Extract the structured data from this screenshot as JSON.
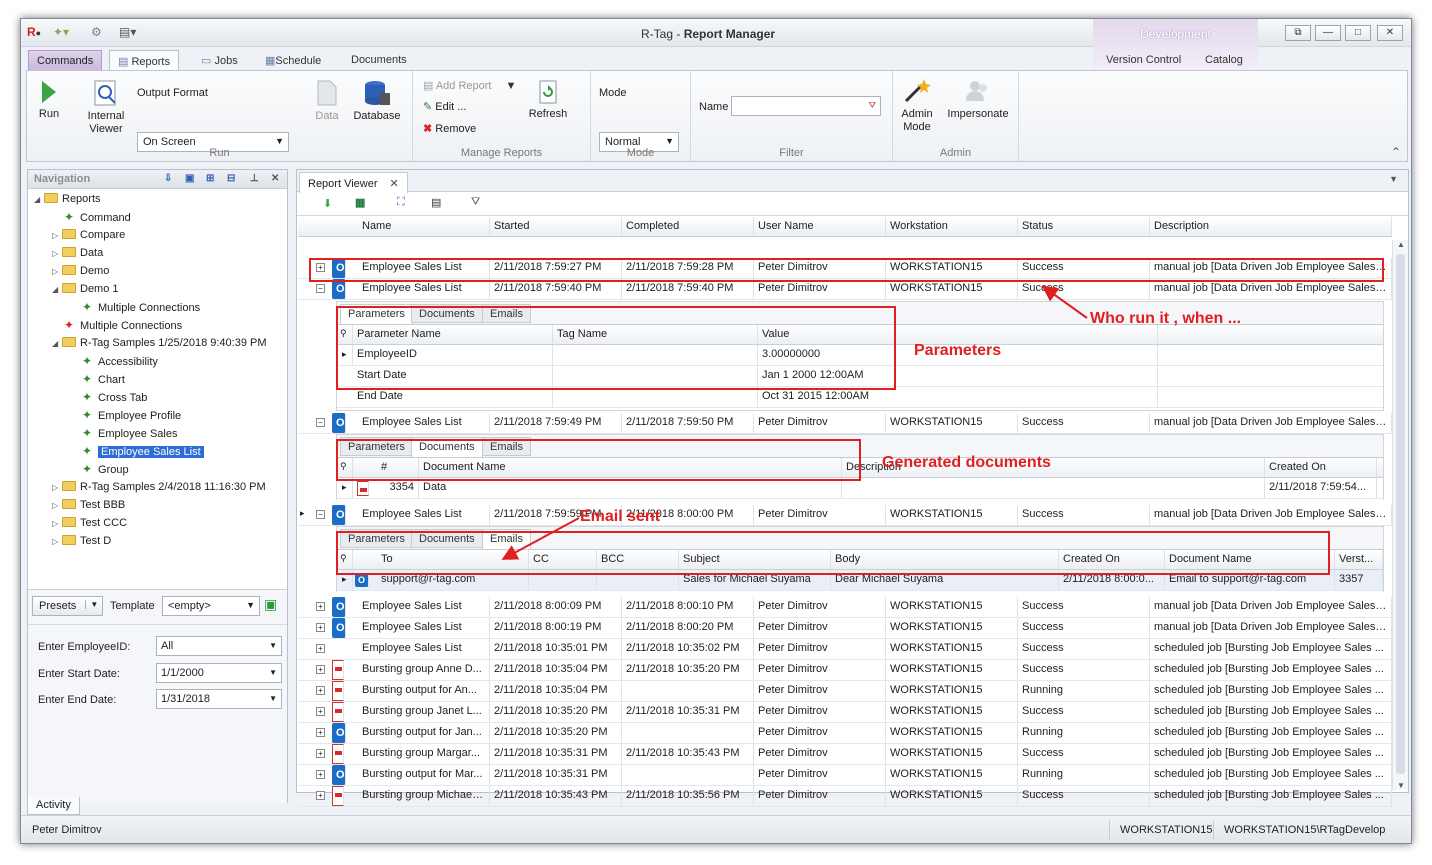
{
  "window": {
    "title_prefix": "R-Tag - ",
    "title_main": "Report Manager",
    "context_tab": "Development",
    "controls": [
      "⧉",
      "—",
      "□",
      "✕"
    ]
  },
  "ribbon_tabs": {
    "commands": "Commands",
    "reports": "Reports",
    "jobs": "Jobs",
    "schedule": "Schedule",
    "documents": "Documents",
    "version_control": "Version Control",
    "catalog": "Catalog"
  },
  "ribbon": {
    "run": "Run",
    "internal_viewer_1": "Internal",
    "internal_viewer_2": "Viewer",
    "output_format_label": "Output Format",
    "output_format_value": "On Screen",
    "data": "Data",
    "database": "Database",
    "group_run": "Run",
    "add_report": "Add Report",
    "edit": "Edit ...",
    "remove": "Remove",
    "refresh": "Refresh",
    "group_manage": "Manage Reports",
    "mode_label": "Mode",
    "mode_value": "Normal",
    "group_mode": "Mode",
    "name_label": "Name",
    "name_value": "",
    "group_filter": "Filter",
    "admin_mode_1": "Admin",
    "admin_mode_2": "Mode",
    "impersonate": "Impersonate",
    "group_admin": "Admin"
  },
  "navigation": {
    "title": "Navigation",
    "tree": [
      {
        "label": "Reports",
        "type": "folder",
        "exp": "◢",
        "indent": 0
      },
      {
        "label": "Command",
        "type": "report",
        "exp": "",
        "indent": 1
      },
      {
        "label": "Compare",
        "type": "folder",
        "exp": "▷",
        "indent": 1
      },
      {
        "label": "Data",
        "type": "folder",
        "exp": "▷",
        "indent": 1
      },
      {
        "label": "Demo",
        "type": "folder",
        "exp": "▷",
        "indent": 1
      },
      {
        "label": "Demo 1",
        "type": "folder",
        "exp": "◢",
        "indent": 1
      },
      {
        "label": "Multiple  Connections",
        "type": "report",
        "exp": "",
        "indent": 2
      },
      {
        "label": "Multiple  Connections",
        "type": "report",
        "exp": "",
        "indent": 1
      },
      {
        "label": "R-Tag Samples 1/25/2018 9:40:39 PM",
        "type": "folder",
        "exp": "◢",
        "indent": 1
      },
      {
        "label": "Accessibility",
        "type": "report",
        "exp": "",
        "indent": 2
      },
      {
        "label": "Chart",
        "type": "report",
        "exp": "",
        "indent": 2
      },
      {
        "label": "Cross Tab",
        "type": "report",
        "exp": "",
        "indent": 2
      },
      {
        "label": "Employee  Profile",
        "type": "report",
        "exp": "",
        "indent": 2
      },
      {
        "label": "Employee  Sales",
        "type": "report",
        "exp": "",
        "indent": 2
      },
      {
        "label": "Employee Sales List",
        "type": "report",
        "exp": "",
        "indent": 2,
        "selected": true
      },
      {
        "label": "Group",
        "type": "report",
        "exp": "",
        "indent": 2
      },
      {
        "label": "R-Tag Samples 2/4/2018 11:16:30 PM",
        "type": "folder",
        "exp": "▷",
        "indent": 1
      },
      {
        "label": "Test BBB",
        "type": "folder",
        "exp": "▷",
        "indent": 1
      },
      {
        "label": "Test CCC",
        "type": "folder",
        "exp": "▷",
        "indent": 1
      },
      {
        "label": "Test D",
        "type": "folder",
        "exp": "▷",
        "indent": 1
      }
    ],
    "presets": "Presets",
    "template_label": "Template",
    "template_value": "<empty>",
    "params": [
      {
        "label": "Enter EmployeeID:",
        "value": "All"
      },
      {
        "label": "Enter Start Date:",
        "value": "1/1/2000"
      },
      {
        "label": "Enter End Date:",
        "value": "1/31/2018"
      }
    ],
    "activity": "Activity"
  },
  "viewer": {
    "tab": "Report Viewer",
    "columns": [
      "Name",
      "Started",
      "Completed",
      "User Name",
      "Workstation",
      "Status",
      "Description"
    ],
    "rows": [
      {
        "icon": "ol",
        "exp": "+",
        "name": "Employee Sales List",
        "started": "2/11/2018 7:59:27 PM",
        "completed": "2/11/2018 7:59:28 PM",
        "user": "Peter Dimitrov",
        "ws": "WORKSTATION15",
        "status": "Success",
        "desc": "manual job [Data Driven Job Employee Sales ..."
      },
      {
        "icon": "ol",
        "exp": "−",
        "name": "Employee Sales List",
        "started": "2/11/2018 7:59:40 PM",
        "completed": "2/11/2018 7:59:40 PM",
        "user": "Peter Dimitrov",
        "ws": "WORKSTATION15",
        "status": "Success",
        "desc": "manual job [Data Driven Job Employee Sales ..."
      },
      {
        "icon": "ol",
        "exp": "−",
        "name": "Employee Sales List",
        "started": "2/11/2018 7:59:49 PM",
        "completed": "2/11/2018 7:59:50 PM",
        "user": "Peter Dimitrov",
        "ws": "WORKSTATION15",
        "status": "Success",
        "desc": "manual job [Data Driven Job Employee Sales ..."
      },
      {
        "icon": "ol",
        "exp": "−",
        "name": "Employee Sales List",
        "started": "2/11/2018 7:59:59 PM",
        "completed": "2/11/2018 8:00:00 PM",
        "user": "Peter Dimitrov",
        "ws": "WORKSTATION15",
        "status": "Success",
        "desc": "manual job [Data Driven Job Employee Sales ..."
      },
      {
        "icon": "ol",
        "exp": "+",
        "name": "Employee Sales List",
        "started": "2/11/2018 8:00:09 PM",
        "completed": "2/11/2018 8:00:10 PM",
        "user": "Peter Dimitrov",
        "ws": "WORKSTATION15",
        "status": "Success",
        "desc": "manual job [Data Driven Job Employee Sales ..."
      },
      {
        "icon": "ol",
        "exp": "+",
        "name": "Employee Sales List",
        "started": "2/11/2018 8:00:19 PM",
        "completed": "2/11/2018 8:00:20 PM",
        "user": "Peter Dimitrov",
        "ws": "WORKSTATION15",
        "status": "Success",
        "desc": "manual job [Data Driven Job Employee Sales ..."
      },
      {
        "icon": "",
        "exp": "+",
        "name": "Employee Sales List",
        "started": "2/11/2018 10:35:01 PM",
        "completed": "2/11/2018 10:35:02 PM",
        "user": "Peter Dimitrov",
        "ws": "WORKSTATION15",
        "status": "Success",
        "desc": "scheduled job [Bursting Job Employee Sales ..."
      },
      {
        "icon": "pdf",
        "exp": "+",
        "name": "Bursting group Anne D...",
        "started": "2/11/2018 10:35:04 PM",
        "completed": "2/11/2018 10:35:20 PM",
        "user": "Peter Dimitrov",
        "ws": "WORKSTATION15",
        "status": "Success",
        "desc": "scheduled job [Bursting Job Employee Sales ..."
      },
      {
        "icon": "pdf",
        "exp": "+",
        "name": "Bursting output for An...",
        "started": "2/11/2018 10:35:04 PM",
        "completed": "",
        "user": "Peter Dimitrov",
        "ws": "WORKSTATION15",
        "status": "Running",
        "desc": "scheduled job [Bursting Job Employee Sales ..."
      },
      {
        "icon": "pdf",
        "exp": "+",
        "name": "Bursting group Janet L...",
        "started": "2/11/2018 10:35:20 PM",
        "completed": "2/11/2018 10:35:31 PM",
        "user": "Peter Dimitrov",
        "ws": "WORKSTATION15",
        "status": "Success",
        "desc": "scheduled job [Bursting Job Employee Sales ..."
      },
      {
        "icon": "ol",
        "exp": "+",
        "name": "Bursting output for Jan...",
        "started": "2/11/2018 10:35:20 PM",
        "completed": "",
        "user": "Peter Dimitrov",
        "ws": "WORKSTATION15",
        "status": "Running",
        "desc": "scheduled job [Bursting Job Employee Sales ..."
      },
      {
        "icon": "pdf",
        "exp": "+",
        "name": "Bursting group Margar...",
        "started": "2/11/2018 10:35:31 PM",
        "completed": "2/11/2018 10:35:43 PM",
        "user": "Peter Dimitrov",
        "ws": "WORKSTATION15",
        "status": "Success",
        "desc": "scheduled job [Bursting Job Employee Sales ..."
      },
      {
        "icon": "ol",
        "exp": "+",
        "name": "Bursting output for Mar...",
        "started": "2/11/2018 10:35:31 PM",
        "completed": "",
        "user": "Peter Dimitrov",
        "ws": "WORKSTATION15",
        "status": "Running",
        "desc": "scheduled job [Bursting Job Employee Sales ..."
      },
      {
        "icon": "pdf",
        "exp": "+",
        "name": "Bursting group Michael ...",
        "started": "2/11/2018 10:35:43 PM",
        "completed": "2/11/2018 10:35:56 PM",
        "user": "Peter Dimitrov",
        "ws": "WORKSTATION15",
        "status": "Success",
        "desc": "scheduled job [Bursting Job Employee Sales ..."
      }
    ],
    "detail_tabs": [
      "Parameters",
      "Documents",
      "Emails"
    ],
    "params_table": {
      "columns": [
        "Parameter Name",
        "Tag Name",
        "Value"
      ],
      "rows": [
        [
          "EmployeeID",
          "",
          "3.00000000"
        ],
        [
          "Start Date",
          "",
          "Jan  1 2000 12:00AM"
        ],
        [
          "End Date",
          "",
          "Oct 31 2015 12:00AM"
        ]
      ]
    },
    "docs_table": {
      "columns": [
        "#",
        "Document Name",
        "Description",
        "Created On"
      ],
      "row": [
        "3354",
        "Data",
        "",
        "2/11/2018 7:59:54..."
      ]
    },
    "emails_table": {
      "columns": [
        "To",
        "CC",
        "BCC",
        "Subject",
        "Body",
        "Created On",
        "Document Name",
        "Verst..."
      ],
      "row": [
        "support@r-tag.com",
        "",
        "",
        "Sales for Michael Suyama",
        "Dear  Michael Suyama",
        "2/11/2018 8:00:0...",
        "Email to support@r-tag.com",
        "3357"
      ]
    }
  },
  "annotations": {
    "who": "Who run it , when ...",
    "params": "Parameters",
    "docs": "Generated documents",
    "email": "Email sent"
  },
  "statusbar": {
    "user": "Peter Dimitrov",
    "workstation": "WORKSTATION15",
    "connection": "WORKSTATION15\\RTagDevelop"
  }
}
